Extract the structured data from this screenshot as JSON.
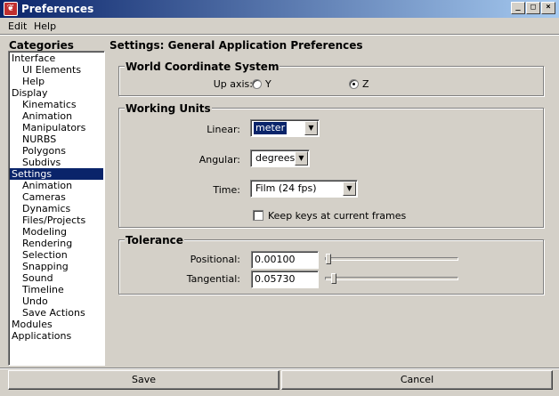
{
  "window": {
    "title": "Preferences",
    "icon": "maya-app-icon",
    "minimize_glyph": "_",
    "maximize_glyph": "□",
    "close_glyph": "×"
  },
  "menu": {
    "items": [
      "Edit",
      "Help"
    ]
  },
  "categories": {
    "title": "Categories",
    "items": [
      {
        "label": "Interface",
        "level": 1
      },
      {
        "label": "UI Elements",
        "level": 2
      },
      {
        "label": "Help",
        "level": 2
      },
      {
        "label": "Display",
        "level": 1
      },
      {
        "label": "Kinematics",
        "level": 2
      },
      {
        "label": "Animation",
        "level": 2
      },
      {
        "label": "Manipulators",
        "level": 2
      },
      {
        "label": "NURBS",
        "level": 2
      },
      {
        "label": "Polygons",
        "level": 2
      },
      {
        "label": "Subdivs",
        "level": 2
      },
      {
        "label": "Settings",
        "level": 1,
        "selected": true
      },
      {
        "label": "Animation",
        "level": 2
      },
      {
        "label": "Cameras",
        "level": 2
      },
      {
        "label": "Dynamics",
        "level": 2
      },
      {
        "label": "Files/Projects",
        "level": 2
      },
      {
        "label": "Modeling",
        "level": 2
      },
      {
        "label": "Rendering",
        "level": 2
      },
      {
        "label": "Selection",
        "level": 2
      },
      {
        "label": "Snapping",
        "level": 2
      },
      {
        "label": "Sound",
        "level": 2
      },
      {
        "label": "Timeline",
        "level": 2
      },
      {
        "label": "Undo",
        "level": 2
      },
      {
        "label": "Save Actions",
        "level": 2
      },
      {
        "label": "Modules",
        "level": 1
      },
      {
        "label": "Applications",
        "level": 1
      }
    ]
  },
  "settings": {
    "title": "Settings: General Application Preferences",
    "world": {
      "title": "World Coordinate System",
      "up_axis_label": "Up axis:",
      "options": [
        {
          "label": "Y",
          "selected": false
        },
        {
          "label": "Z",
          "selected": true
        }
      ]
    },
    "units": {
      "title": "Working Units",
      "linear_label": "Linear:",
      "linear_value": "meter",
      "angular_label": "Angular:",
      "angular_value": "degrees",
      "time_label": "Time:",
      "time_value": "Film (24 fps)",
      "keep_keys_label": "Keep keys at current frames",
      "keep_keys_checked": false
    },
    "tolerance": {
      "title": "Tolerance",
      "positional_label": "Positional:",
      "positional_value": "0.00100",
      "positional_slider_fraction": 0.01,
      "tangential_label": "Tangential:",
      "tangential_value": "0.05730",
      "tangential_slider_fraction": 0.05
    }
  },
  "buttons": {
    "save": "Save",
    "cancel": "Cancel"
  },
  "colors": {
    "selection": "#0a246a",
    "face": "#d4d0c8"
  }
}
